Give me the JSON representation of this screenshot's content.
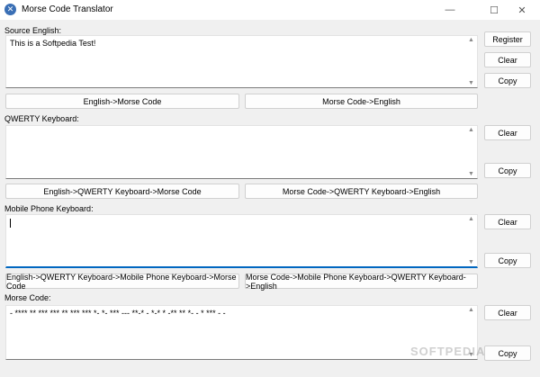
{
  "window": {
    "title": "Morse Code Translator",
    "icon": "morse-app-icon",
    "controls": {
      "minimize": "—",
      "maximize": "☐",
      "close": "✕"
    }
  },
  "source": {
    "label": "Source English:",
    "value": "This is a Softpedia Test!",
    "buttons": {
      "register": "Register",
      "clear": "Clear",
      "copy": "Copy"
    }
  },
  "convert_row1": {
    "english_to_morse": "English->Morse Code",
    "morse_to_english": "Morse Code->English"
  },
  "qwerty": {
    "label": "QWERTY Keyboard:",
    "value": "",
    "buttons": {
      "clear": "Clear",
      "copy": "Copy"
    }
  },
  "convert_row2": {
    "english_qwerty_morse": "English->QWERTY Keyboard->Morse Code",
    "morse_qwerty_english": "Morse Code->QWERTY Keyboard->English"
  },
  "mobile": {
    "label": "Mobile Phone Keyboard:",
    "value": "",
    "buttons": {
      "clear": "Clear",
      "copy": "Copy"
    }
  },
  "convert_row3": {
    "english_qwerty_mobile_morse": "English->QWERTY Keyboard->Mobile Phone Keyboard->Morse Code",
    "morse_mobile_qwerty_english": "Morse Code->Mobile Phone Keyboard->QWERTY Keyboard->English"
  },
  "morse": {
    "label": "Morse Code:",
    "value": "- **** ** *** *** ** *** *** *- *- *** --- **-* - *-* * -** ** *- - * *** - -",
    "buttons": {
      "clear": "Clear",
      "copy": "Copy"
    }
  },
  "watermark": "SOFTPEDIA"
}
